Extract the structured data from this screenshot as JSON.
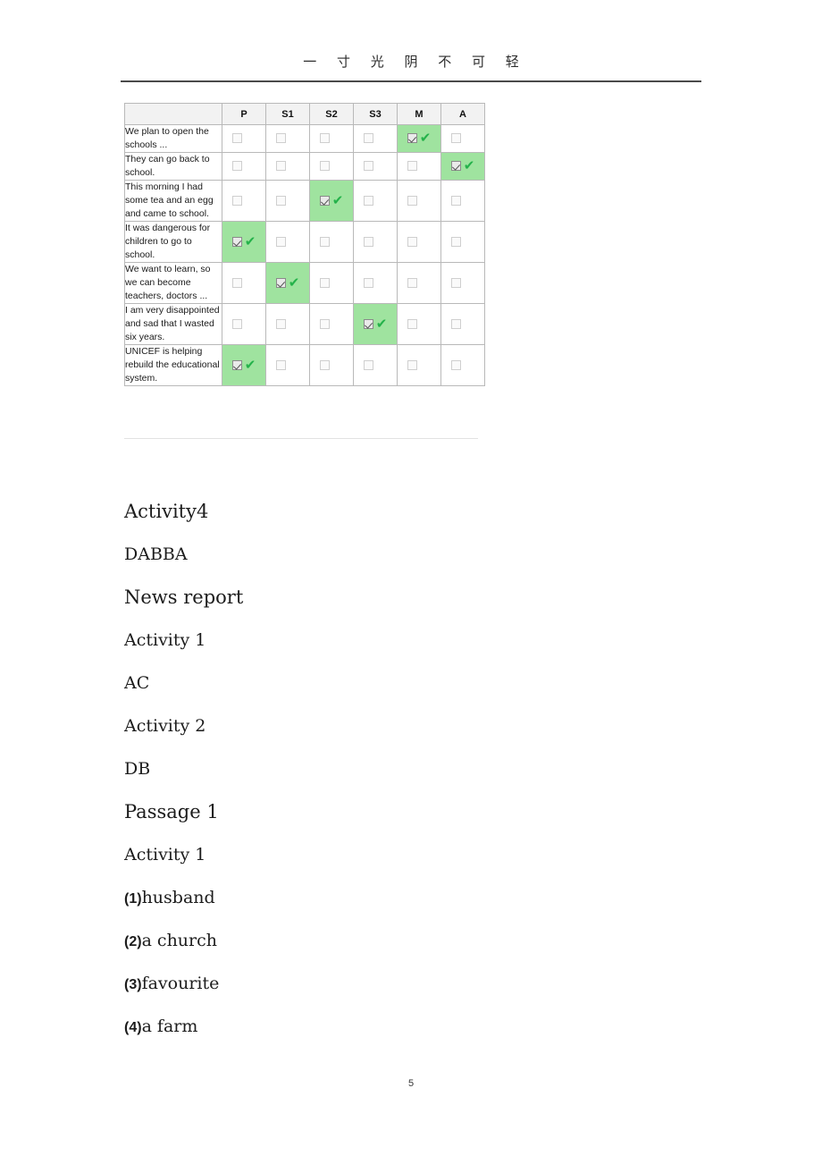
{
  "header": {
    "title": "一 寸 光 阴 不 可 轻"
  },
  "answer_table": {
    "columns": [
      "",
      "P",
      "S1",
      "S2",
      "S3",
      "M",
      "A"
    ],
    "rows": [
      {
        "stem": "We plan to open the schools ...",
        "marked": "M"
      },
      {
        "stem": "They can go back to school.",
        "marked": "A"
      },
      {
        "stem": "This morning I had some tea and an egg and came to school.",
        "marked": "S2"
      },
      {
        "stem": "It was dangerous for children to go to school.",
        "marked": "P"
      },
      {
        "stem": "We want to learn, so we can become teachers, doctors ...",
        "marked": "S1"
      },
      {
        "stem": "I am very disappointed and sad that I wasted six years.",
        "marked": "S3"
      },
      {
        "stem": "UNICEF is helping rebuild the educational system.",
        "marked": "P"
      }
    ]
  },
  "answers": {
    "lines": [
      {
        "text": "Activity4",
        "size": "lg"
      },
      {
        "text": "DABBA",
        "size": "md"
      },
      {
        "text": "News report",
        "size": "lg"
      },
      {
        "text": "Activity 1",
        "size": "md"
      },
      {
        "text": "AC",
        "size": "md"
      },
      {
        "text": "Activity 2",
        "size": "md"
      },
      {
        "text": "DB",
        "size": "md"
      },
      {
        "text": "Passage 1",
        "size": "lg"
      },
      {
        "text": "Activity 1",
        "size": "md"
      }
    ],
    "numbered": [
      {
        "num": "(1)",
        "word": "husband"
      },
      {
        "num": "(2)",
        "word": "a church"
      },
      {
        "num": "(3)",
        "word": "favourite"
      },
      {
        "num": "(4)",
        "word": "a farm"
      }
    ]
  },
  "footer": {
    "page_number": "5"
  },
  "colors": {
    "highlight": "#9fe39f",
    "tick": "#24b24a",
    "header_rule": "#4a4a4a",
    "table_border": "#b9b9b9",
    "table_head_bg": "#f2f2f2"
  }
}
